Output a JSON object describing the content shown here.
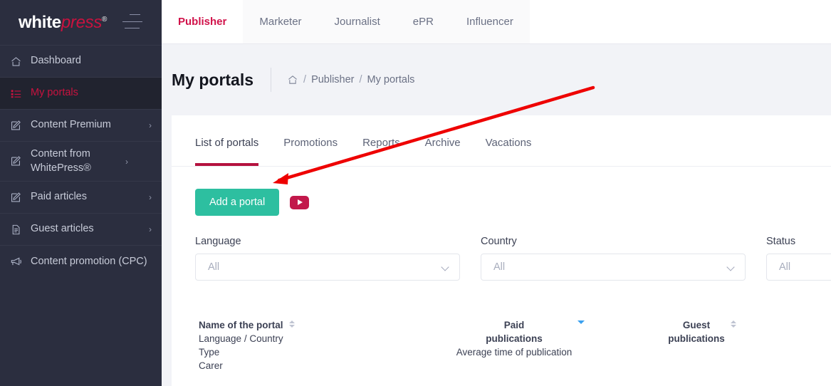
{
  "brand": {
    "logo_part1": "white",
    "logo_part2": "press",
    "logo_reg": "®",
    "accent_crimson": "#c9123f",
    "accent_teal": "#2dbfa0",
    "sidebar_bg": "#2b2e3f",
    "annotation_color": "#ee0000"
  },
  "sidebar": {
    "menu_icon": "hamburger-collapse-icon",
    "items": [
      {
        "label": "Dashboard",
        "icon": "home-icon",
        "active": false,
        "has_chevron": false
      },
      {
        "label": "My portals",
        "icon": "list-icon",
        "active": true,
        "has_chevron": false
      },
      {
        "label": "Content Premium",
        "icon": "edit-square-icon",
        "active": false,
        "has_chevron": true
      },
      {
        "label": "Content from WhitePress®",
        "icon": "edit-square-icon",
        "active": false,
        "has_chevron": true
      },
      {
        "label": "Paid articles",
        "icon": "edit-square-icon",
        "active": false,
        "has_chevron": true
      },
      {
        "label": "Guest articles",
        "icon": "document-icon",
        "active": false,
        "has_chevron": true
      },
      {
        "label": "Content promotion (CPC)",
        "icon": "megaphone-icon",
        "active": false,
        "has_chevron": false
      }
    ],
    "chevron_glyph": "›"
  },
  "topnav": {
    "tabs": [
      {
        "label": "Publisher",
        "active": true
      },
      {
        "label": "Marketer",
        "active": false
      },
      {
        "label": "Journalist",
        "active": false
      },
      {
        "label": "ePR",
        "active": false
      },
      {
        "label": "Influencer",
        "active": false
      }
    ]
  },
  "pagehead": {
    "title": "My portals",
    "breadcrumb": {
      "home_icon": "home-icon",
      "slash": "/",
      "items": [
        "Publisher",
        "My portals"
      ]
    }
  },
  "card": {
    "tabs": [
      {
        "label": "List of portals",
        "active": true
      },
      {
        "label": "Promotions",
        "active": false
      },
      {
        "label": "Reports",
        "active": false
      },
      {
        "label": "Archive",
        "active": false
      },
      {
        "label": "Vacations",
        "active": false
      }
    ],
    "actions": {
      "add_portal_label": "Add a portal",
      "video_icon": "youtube-play-icon"
    },
    "filters": [
      {
        "label": "Language",
        "value": "All",
        "icon": "chevron-down-icon"
      },
      {
        "label": "Country",
        "value": "All",
        "icon": "chevron-down-icon"
      },
      {
        "label": "Status",
        "value": "All",
        "icon": "chevron-down-icon"
      }
    ],
    "table": {
      "columns": [
        {
          "lines": [
            "Name of the portal",
            "Language / Country",
            "Type",
            "Carer"
          ],
          "sort": "none",
          "sort_icon": "sort-both-icon"
        },
        {
          "lines": [
            "Paid",
            "publications",
            "Average time of publication"
          ],
          "sort": "desc",
          "sort_icon": "sort-desc-icon"
        },
        {
          "lines": [
            "Guest",
            "publications"
          ],
          "sort": "none",
          "sort_icon": "sort-both-icon"
        }
      ]
    }
  }
}
